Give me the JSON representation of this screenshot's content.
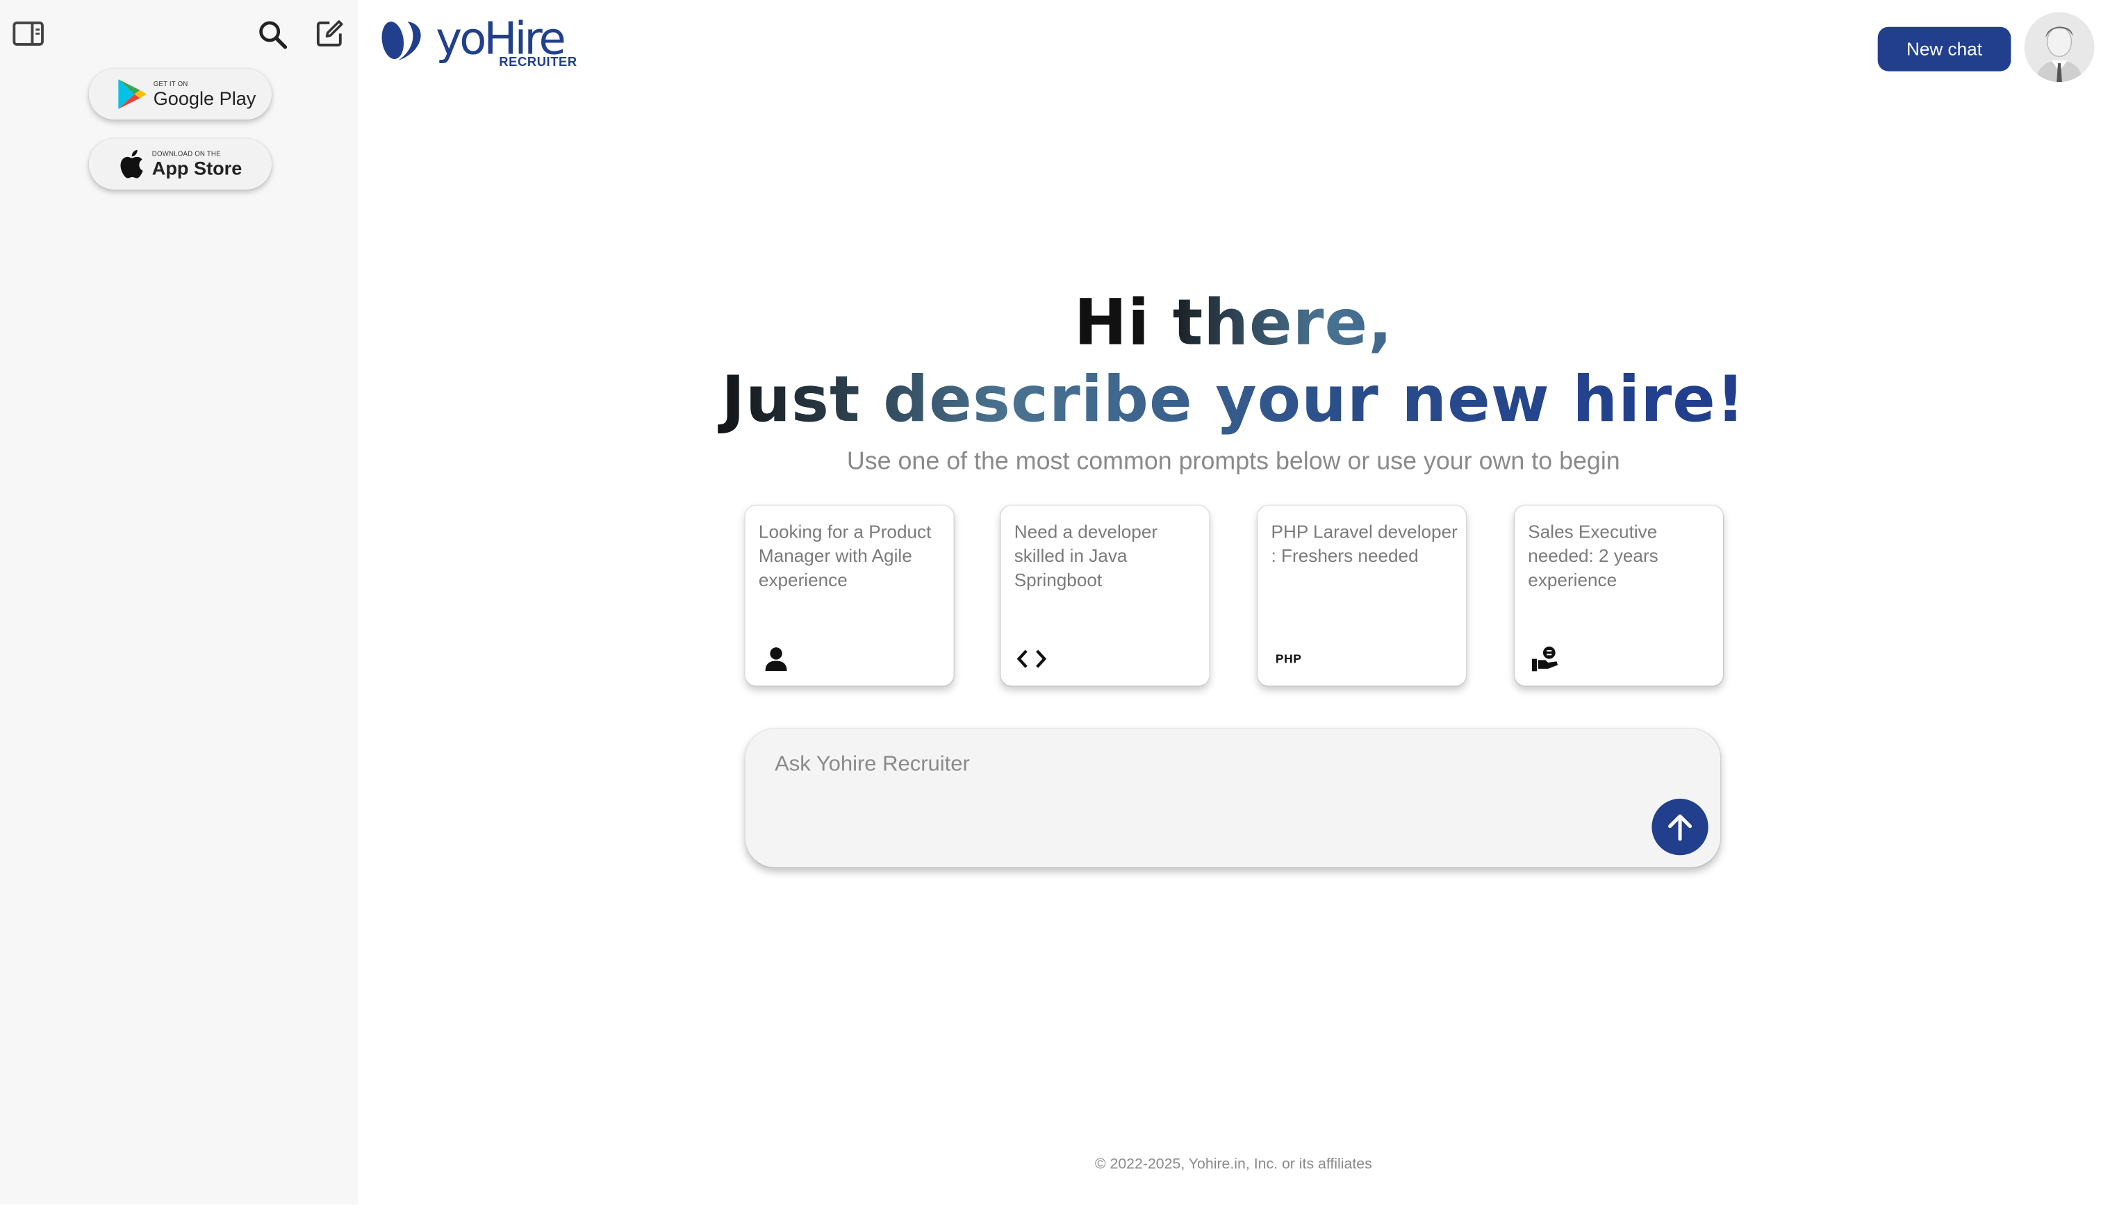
{
  "sidebar": {
    "google_play": {
      "small": "GET IT ON",
      "big": "Google Play"
    },
    "app_store": {
      "small": "DOWNLOAD ON THE",
      "big": "App Store"
    }
  },
  "header": {
    "logo_word": "yoHire",
    "logo_sub": "RECRUITER",
    "new_chat_label": "New chat"
  },
  "hero": {
    "line1": "Hi there,",
    "line2": "Just describe your new hire!",
    "subtitle": "Use one of the most common prompts below or use your own to begin"
  },
  "cards": [
    {
      "text": "Looking for a Product Manager with Agile experience",
      "icon": "person-icon"
    },
    {
      "text": "Need a developer skilled in Java Springboot",
      "icon": "code-icon"
    },
    {
      "text": "PHP Laravel developer : Freshers needed",
      "icon": "php-icon",
      "icon_text": "PHP"
    },
    {
      "text": "Sales Executive needed: 2 years experience",
      "icon": "sales-hand-icon"
    }
  ],
  "prompt": {
    "placeholder": "Ask Yohire Recruiter"
  },
  "footer": {
    "text": "© 2022-2025, Yohire.in, Inc. or its affiliates"
  },
  "colors": {
    "brand": "#213f8d",
    "sidebar_bg": "#f7f7f7",
    "muted_text": "#8a8a8a"
  }
}
